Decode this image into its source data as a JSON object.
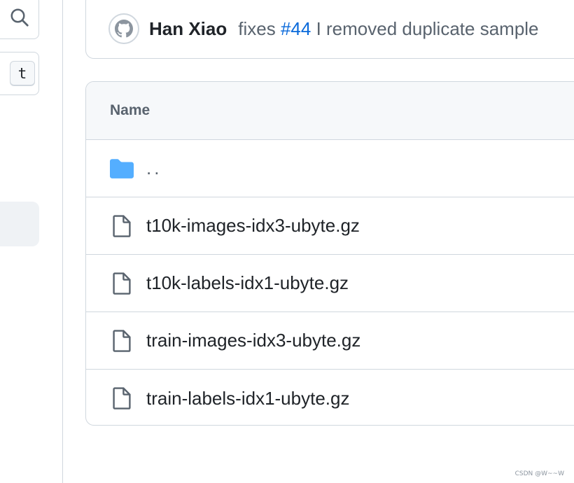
{
  "sidebar": {
    "shortcut_key": "t"
  },
  "commit": {
    "author": "Han Xiao",
    "message_prefix": "fixes",
    "issue_ref": "#44",
    "message_rest": "I removed duplicate sample"
  },
  "files": {
    "header": "Name",
    "parent_link": "..",
    "items": [
      {
        "name": "t10k-images-idx3-ubyte.gz",
        "icon": "file-icon"
      },
      {
        "name": "t10k-labels-idx1-ubyte.gz",
        "icon": "file-icon"
      },
      {
        "name": "train-images-idx3-ubyte.gz",
        "icon": "file-icon"
      },
      {
        "name": "train-labels-idx1-ubyte.gz",
        "icon": "file-icon"
      }
    ]
  },
  "watermark": "CSDN @W~~W",
  "colors": {
    "link": "#0969da",
    "folder": "#54aeff",
    "border": "#d0d7de",
    "header_bg": "#f6f8fa"
  }
}
